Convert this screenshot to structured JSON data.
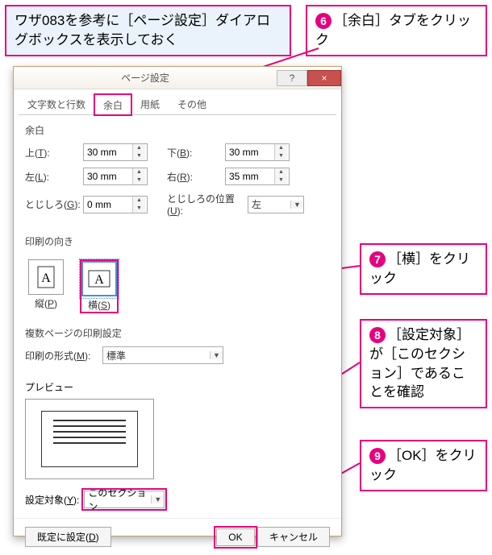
{
  "callouts": {
    "intro": "ワザ083を参考に［ページ設定］ダイアログボックスを表示しておく",
    "c6": "［余白］タブをクリック",
    "c7": "［横］をクリック",
    "c8": "［設定対象］が［このセクション］であることを確認",
    "c9": "［OK］をクリック",
    "n6": "6",
    "n7": "7",
    "n8": "8",
    "n9": "9"
  },
  "dialog": {
    "title": "ページ設定",
    "help": "?",
    "close": "×",
    "tabs": {
      "chars": "文字数と行数",
      "margins": "余白",
      "paper": "用紙",
      "other": "その他"
    },
    "margins": {
      "heading": "余白",
      "top_label_pre": "上(",
      "top_key": "T",
      "top_label_post": "):",
      "bottom_label_pre": "下(",
      "bottom_key": "B",
      "bottom_label_post": "):",
      "left_label_pre": "左(",
      "left_key": "L",
      "left_label_post": "):",
      "right_label_pre": "右(",
      "right_key": "R",
      "right_label_post": "):",
      "gutter_label_pre": "とじしろ(",
      "gutter_key": "G",
      "gutter_label_post": "):",
      "gutterpos_label_pre": "とじしろの位置(",
      "gutterpos_key": "U",
      "gutterpos_label_post": "):",
      "top": "30 mm",
      "bottom": "30 mm",
      "left": "30 mm",
      "right": "35 mm",
      "gutter": "0 mm",
      "gutter_pos": "左"
    },
    "orientation": {
      "heading": "印刷の向き",
      "portrait_pre": "縦(",
      "portrait_key": "P",
      "portrait_post": ")",
      "landscape_pre": "横(",
      "landscape_key": "S",
      "landscape_post": ")"
    },
    "multipage": {
      "heading": "複数ページの印刷設定",
      "format_label_pre": "印刷の形式(",
      "format_key": "M",
      "format_label_post": "):",
      "format": "標準"
    },
    "preview": {
      "heading": "プレビュー"
    },
    "apply": {
      "label_pre": "設定対象(",
      "key": "Y",
      "label_post": "):",
      "value": "このセクション"
    },
    "footer": {
      "default_pre": "既定に設定(",
      "default_key": "D",
      "default_post": ")",
      "ok": "OK",
      "cancel": "キャンセル"
    }
  }
}
